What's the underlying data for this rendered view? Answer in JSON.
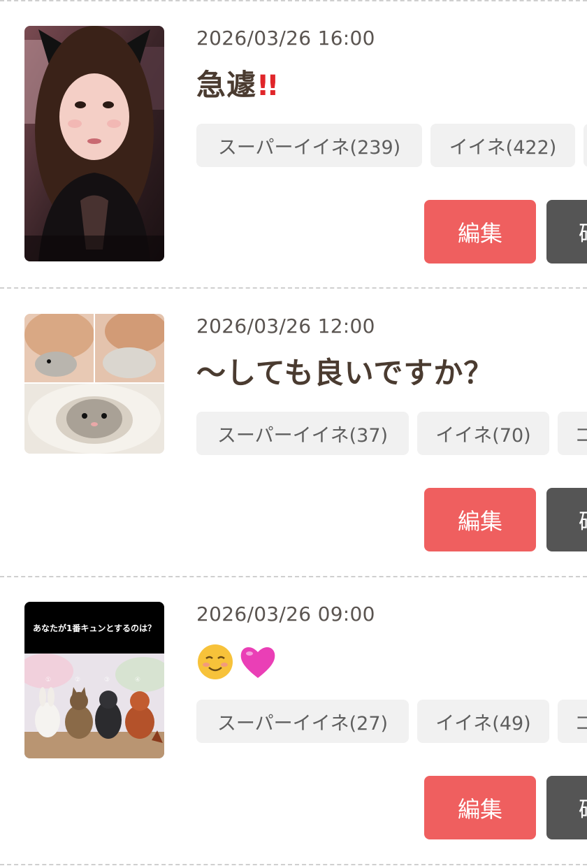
{
  "posts": [
    {
      "date": "2026/03/26 16:00",
      "title": "急遽",
      "title_emoji": "!!",
      "chips": [
        "スーパーイイネ(239)",
        "イイネ(422)",
        ""
      ],
      "edit_label": "編集",
      "second_label": "確",
      "thumb_desc": "portrait"
    },
    {
      "date": "2026/03/26 12:00",
      "title": "〜しても良いですか？",
      "title_emoji": "",
      "chips": [
        "スーパーイイネ(37)",
        "イイネ(70)",
        "コ"
      ],
      "edit_label": "編集",
      "second_label": "確",
      "thumb_desc": "hamster"
    },
    {
      "date": "2026/03/26 09:00",
      "title": "",
      "title_emoji": "☺💗",
      "chips": [
        "スーパーイイネ(27)",
        "イイネ(49)",
        "コ"
      ],
      "edit_label": "編集",
      "second_label": "確",
      "thumb_caption": "あなたが1番キュンとするのは？",
      "thumb_desc": "animals"
    }
  ],
  "colors": {
    "edit": "#ef5f5f",
    "dark": "#555555",
    "chip": "#f1f1f1",
    "title": "#4a3b30"
  }
}
